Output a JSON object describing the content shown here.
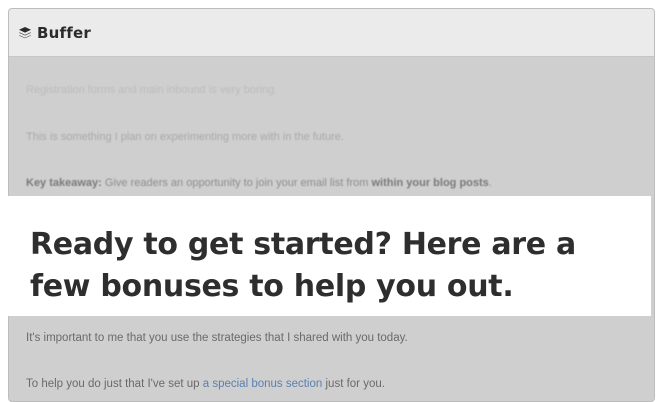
{
  "app": {
    "name": "Buffer",
    "logo_icon": "buffer-stack-icon"
  },
  "article": {
    "faded_line": "Registration forms and main inbound is very boring.",
    "line_2": "This is something I plan on experimenting more with in the future.",
    "takeaway": {
      "label": "Key takeaway:",
      "text_before": " Give readers an opportunity to join your email list from ",
      "bold": "within your blog posts",
      "text_after": "."
    },
    "headline_1": "Ready to get started? Here are a",
    "headline_2": "few bonuses to help you out.",
    "paragraph_1": "It's important to me that you use the strategies that I shared with you today.",
    "paragraph_2": {
      "before": "To help you do just that I've set up ",
      "link": "a special bonus section",
      "after": " just for you."
    }
  },
  "colors": {
    "overlay": "#cfcfcf",
    "highlight": "#ffffff",
    "link": "#5a80b0",
    "headline": "#2e2e2e"
  }
}
